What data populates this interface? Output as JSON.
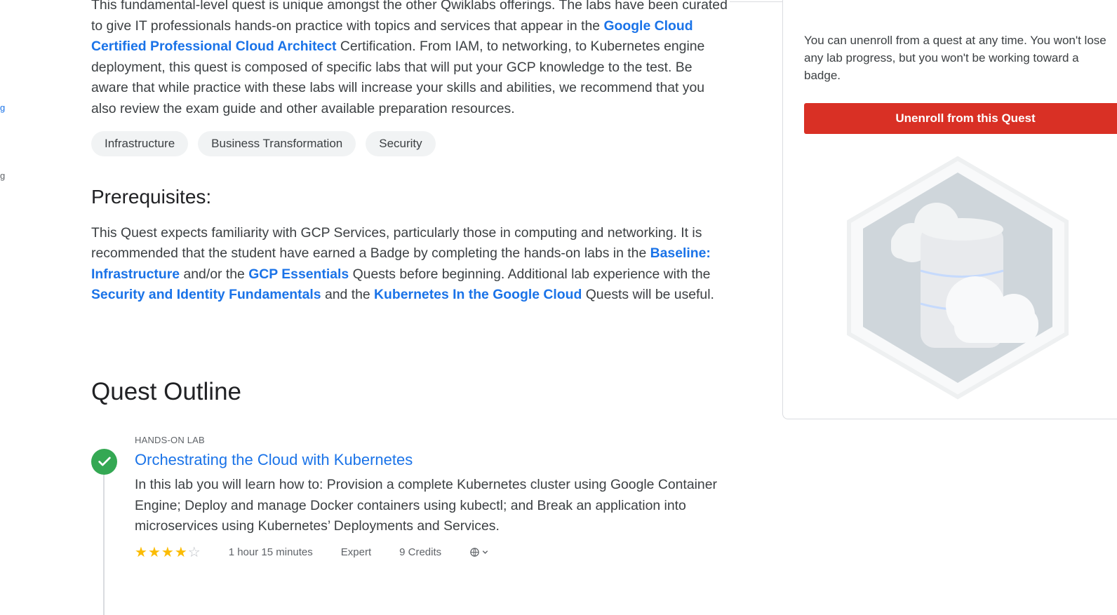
{
  "left_fragments": [
    "g",
    "g"
  ],
  "quest": {
    "description_parts": [
      "This fundamental-level quest is unique amongst the other Qwiklabs offerings. The labs have been curated to give IT professionals hands-on practice with topics and services that appear in the ",
      "Google Cloud Certified Professional Cloud Architect",
      " Certification. From IAM, to networking, to Kubernetes engine deployment, this quest is composed of specific labs that will put your GCP knowledge to the test. Be aware that while practice with these labs will increase your skills and abilities, we recommend that you also review the exam guide and other available preparation resources."
    ],
    "tags": [
      "Infrastructure",
      "Business Transformation",
      "Security"
    ]
  },
  "prerequisites": {
    "heading": "Prerequisites:",
    "text_1": "This Quest expects familiarity with GCP Services, particularly those in computing and networking. It is recommended that the student have earned a Badge by completing the hands-on labs in the ",
    "link_1": "Baseline: Infrastructure",
    "text_2": " and/or the ",
    "link_2": "GCP Essentials",
    "text_3": " Quests before beginning. Additional lab experience with the ",
    "link_3": "Security and Identity Fundamentals",
    "text_4": " and the ",
    "link_4": "Kubernetes In the Google Cloud",
    "text_5": " Quests will be useful."
  },
  "outline": {
    "heading": "Quest Outline",
    "items": [
      {
        "type": "HANDS-ON LAB",
        "title": "Orchestrating the Cloud with Kubernetes",
        "description": "In this lab you will learn how to: Provision a complete Kubernetes cluster using Google Container Engine; Deploy and manage Docker containers using kubectl; and Break an application into microservices using Kubernetes’ Deployments and Services.",
        "rating": 4,
        "rating_max": 5,
        "duration": "1 hour 15 minutes",
        "level": "Expert",
        "credits": "9 Credits",
        "completed": true
      }
    ]
  },
  "sidebar": {
    "unenroll_text": "You can unenroll from a quest at any time. You won't lose any lab progress, but you won't be working toward a badge.",
    "unenroll_button": "Unenroll from this Quest"
  },
  "colors": {
    "link": "#1a73e8",
    "unenroll_button": "#d93025",
    "completed_check": "#34a853",
    "star": "#fbbc04",
    "badge_hex": "#cfd6db"
  },
  "icons": {
    "completed": "check-icon",
    "language": "globe-icon",
    "dropdown": "chevron-down-icon",
    "badge": "cloud-database-badge"
  }
}
